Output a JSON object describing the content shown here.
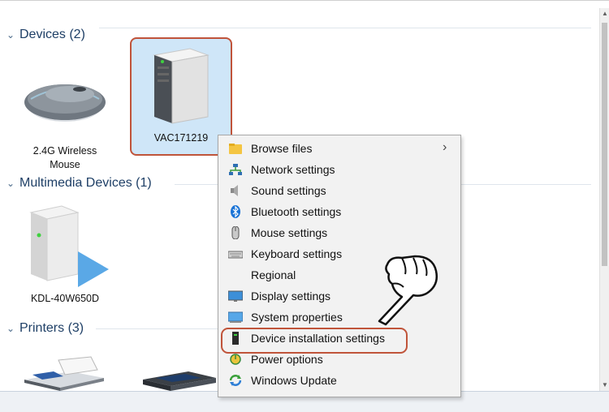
{
  "groups": {
    "devices": {
      "title": "Devices (2)"
    },
    "multimedia": {
      "title": "Multimedia Devices (1)"
    },
    "printers": {
      "title": "Printers (3)"
    }
  },
  "devices": [
    {
      "name_line1": "2.4G Wireless",
      "name_line2": "Mouse",
      "icon": "wireless-mouse-icon"
    },
    {
      "name": "VAC171219",
      "icon": "computer-tower-icon",
      "selected": true
    }
  ],
  "multimedia": [
    {
      "name": "KDL-40W650D",
      "icon": "media-device-icon"
    }
  ],
  "printers": [
    {
      "icon": "fax-printer-icon"
    },
    {
      "icon": "printer-icon"
    }
  ],
  "context_menu": {
    "items": [
      {
        "label": "Browse files",
        "icon": "folder-icon",
        "has_submenu": true
      },
      {
        "label": "Network settings",
        "icon": "network-icon"
      },
      {
        "label": "Sound settings",
        "icon": "speaker-icon"
      },
      {
        "label": "Bluetooth settings",
        "icon": "bluetooth-icon"
      },
      {
        "label": "Mouse settings",
        "icon": "mouse-icon"
      },
      {
        "label": "Keyboard settings",
        "icon": "keyboard-icon"
      },
      {
        "label": "Regional",
        "icon": ""
      },
      {
        "label": "Display settings",
        "icon": "display-icon"
      },
      {
        "label": "System properties",
        "icon": "system-icon"
      },
      {
        "label": "Device installation settings",
        "icon": "device-installation-icon",
        "highlighted": true
      },
      {
        "label": "Power options",
        "icon": "power-icon"
      },
      {
        "label": "Windows Update",
        "icon": "windows-update-icon"
      }
    ]
  },
  "colors": {
    "accent_highlight": "#c0543a",
    "group_title": "#1e3f66",
    "selection_fill": "#cfe6f8",
    "menu_bg": "#f2f2f2"
  }
}
